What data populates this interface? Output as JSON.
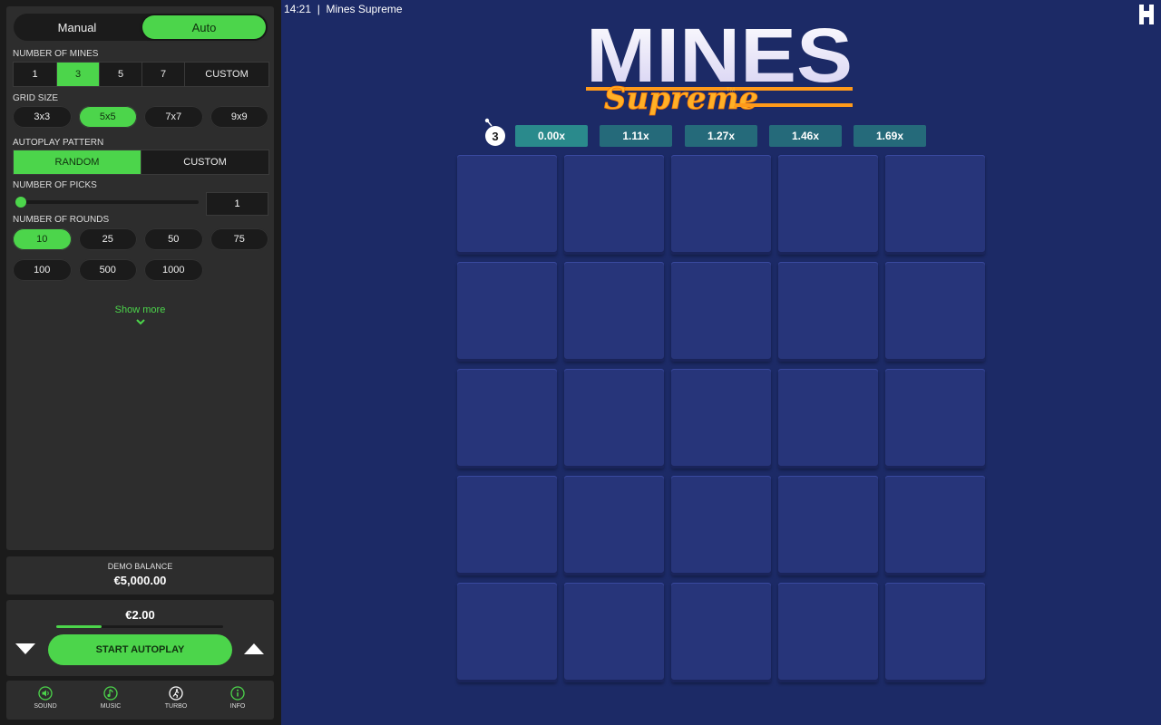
{
  "mode": {
    "manual": "Manual",
    "auto": "Auto",
    "selected": "auto"
  },
  "mines": {
    "label": "NUMBER OF MINES",
    "options": [
      "1",
      "3",
      "5",
      "7",
      "CUSTOM"
    ],
    "selected": "3"
  },
  "grid_size": {
    "label": "GRID SIZE",
    "options": [
      "3x3",
      "5x5",
      "7x7",
      "9x9"
    ],
    "selected": "5x5"
  },
  "pattern": {
    "label": "AUTOPLAY PATTERN",
    "options": [
      "RANDOM",
      "CUSTOM"
    ],
    "selected": "RANDOM"
  },
  "picks": {
    "label": "NUMBER OF PICKS",
    "value": "1",
    "slider_fraction": 0.0
  },
  "rounds": {
    "label": "NUMBER OF ROUNDS",
    "options": [
      "10",
      "25",
      "50",
      "75",
      "100",
      "500",
      "1000"
    ],
    "selected": "10"
  },
  "show_more": "Show more",
  "balance": {
    "label": "DEMO BALANCE",
    "value": "€5,000.00"
  },
  "bet": {
    "amount": "€2.00",
    "fill_fraction": 0.27,
    "start_label": "START AUTOPLAY"
  },
  "footer": {
    "sound": "SOUND",
    "music": "MUSIC",
    "turbo": "TURBO",
    "info": "INFO"
  },
  "header": {
    "time": "14:21",
    "title": "Mines Supreme"
  },
  "logo": {
    "main": "MINES",
    "sub": "Supreme",
    "tm": "™"
  },
  "mine_count": "3",
  "multipliers": [
    "0.00x",
    "1.11x",
    "1.27x",
    "1.46x",
    "1.69x"
  ],
  "tile_count": 25,
  "colors": {
    "accent": "#4cd54b",
    "background": "#1c2a66",
    "tile": "#27357a",
    "multiplier": "#256a7a"
  }
}
